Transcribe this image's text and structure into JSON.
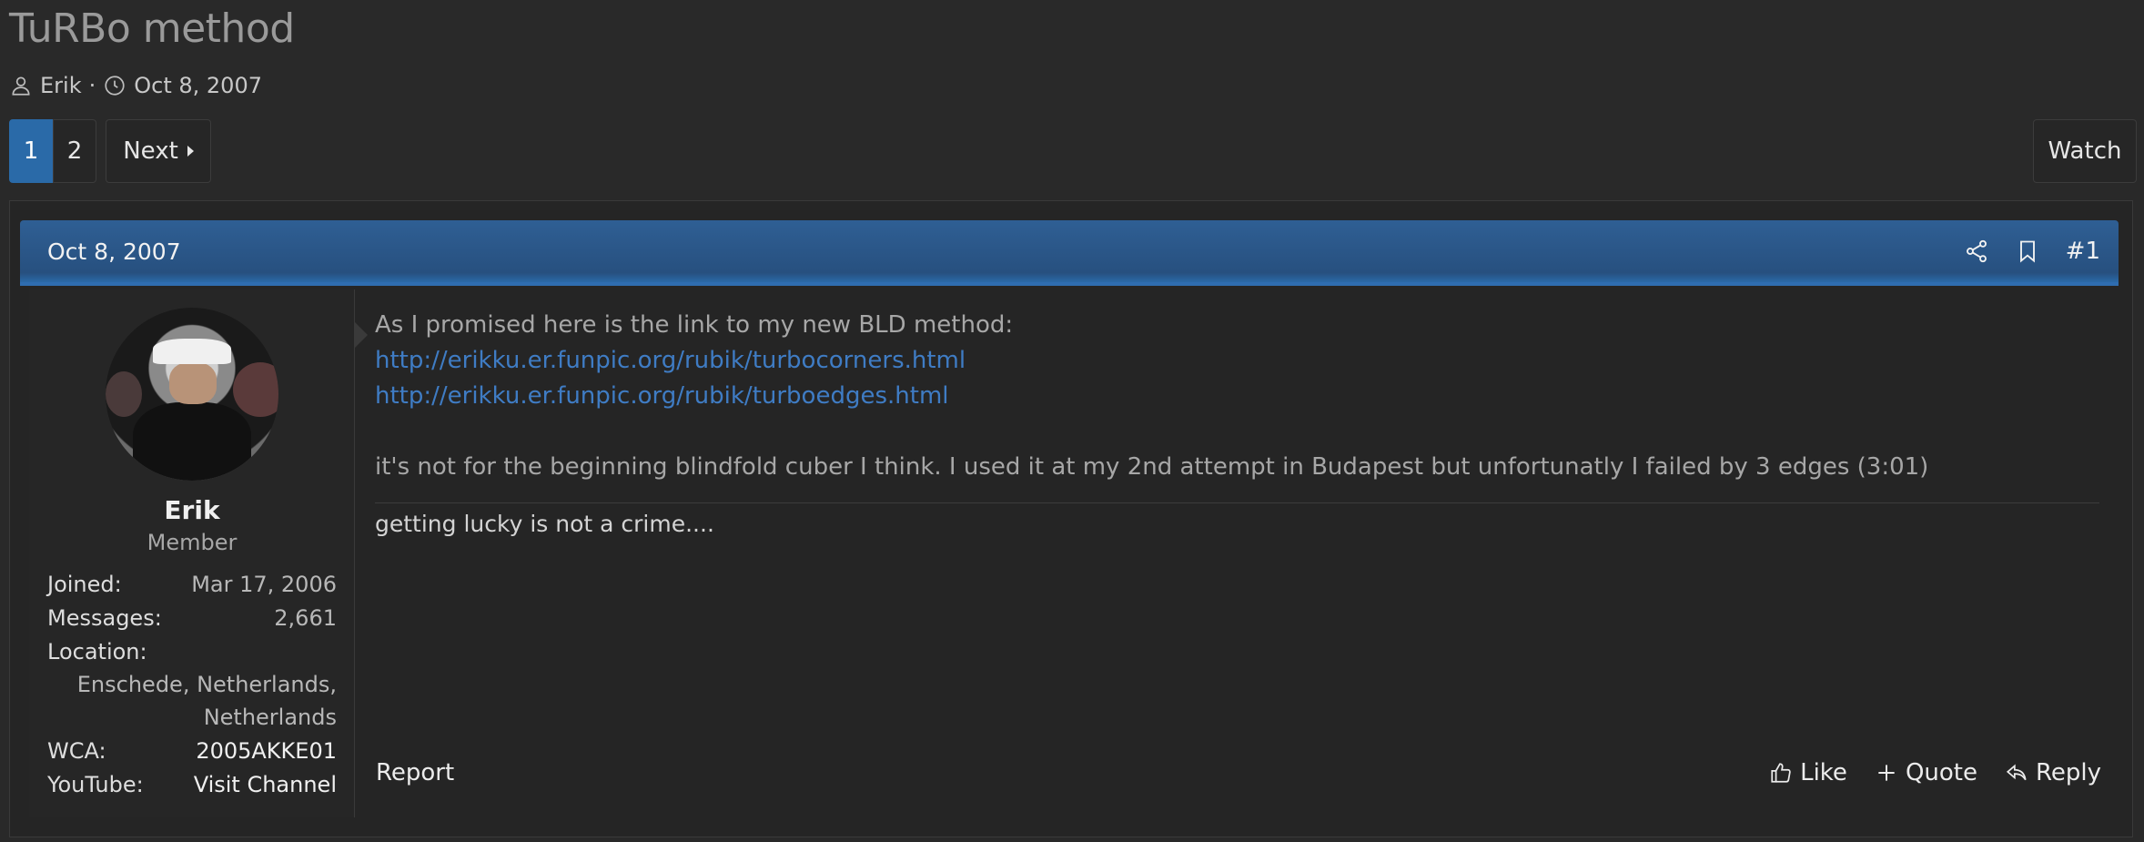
{
  "thread": {
    "title": "TuRBo method",
    "author": "Erik",
    "separator": "·",
    "date": "Oct 8, 2007"
  },
  "pagination": {
    "pages": [
      "1",
      "2"
    ],
    "current": "1",
    "next_label": "Next"
  },
  "watch_label": "Watch",
  "post": {
    "date": "Oct 8, 2007",
    "number": "#1",
    "user": {
      "name": "Erik",
      "role": "Member",
      "stats": {
        "joined_key": "Joined:",
        "joined_val": "Mar 17, 2006",
        "messages_key": "Messages:",
        "messages_val": "2,661",
        "location_key": "Location:",
        "location_line1": "Enschede, Netherlands,",
        "location_line2": "Netherlands",
        "wca_key": "WCA:",
        "wca_val": "2005AKKE01",
        "youtube_key": "YouTube:",
        "youtube_val": "Visit Channel"
      }
    },
    "body": {
      "line1": "As I promised here is the link to my new BLD method:",
      "link1": "http://erikku.er.funpic.org/rubik/turbocorners.html",
      "link2": "http://erikku.er.funpic.org/rubik/turboedges.html",
      "line2": "it's not for the beginning blindfold cuber I think. I used it at my 2nd attempt in Budapest but unfortunatly I failed by 3 edges (3:01)"
    },
    "signature": "getting lucky is not a crime....",
    "actions": {
      "report": "Report",
      "like": "Like",
      "quote": "Quote",
      "reply": "Reply"
    }
  },
  "colors": {
    "background": "#292929",
    "accent": "#2a6aa8",
    "link": "#3f7cc4"
  }
}
